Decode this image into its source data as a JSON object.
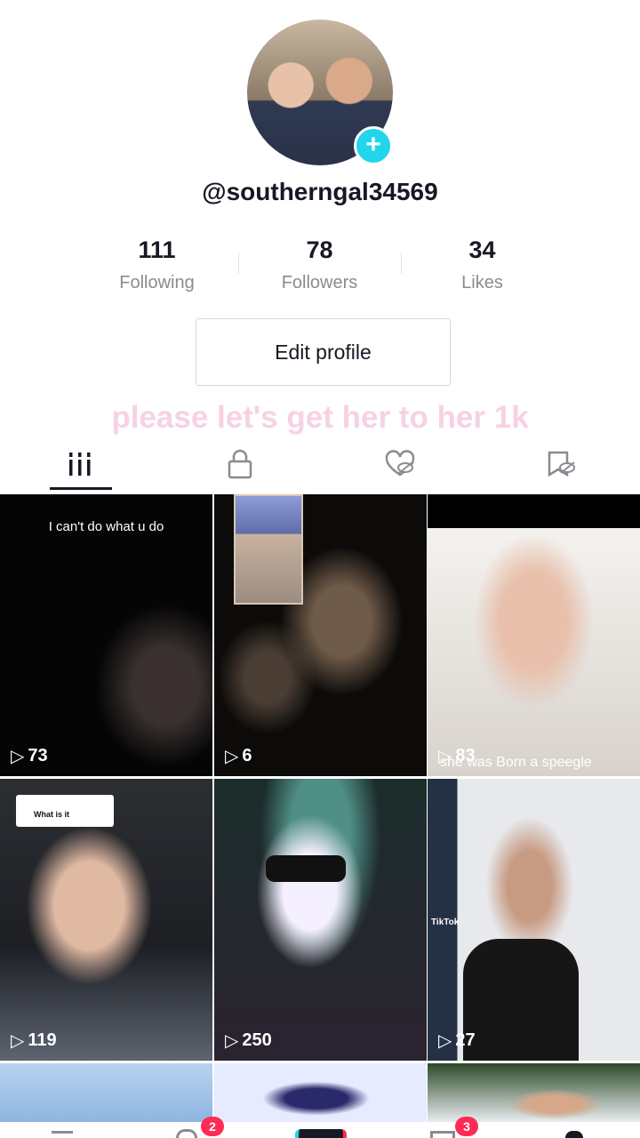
{
  "profile": {
    "username": "@southerngal34569",
    "bio": "please let's get her to her 1k"
  },
  "stats": [
    {
      "value": "111",
      "label": "Following"
    },
    {
      "value": "78",
      "label": "Followers"
    },
    {
      "value": "34",
      "label": "Likes"
    }
  ],
  "actions": {
    "edit_profile": "Edit profile"
  },
  "tabs": [
    {
      "icon": "videos-grid-icon"
    },
    {
      "icon": "private-lock-icon"
    },
    {
      "icon": "liked-heart-hidden-icon"
    },
    {
      "icon": "favorites-hidden-icon"
    }
  ],
  "videos": [
    {
      "views": "73",
      "caption": "I can't do what u do"
    },
    {
      "views": "6",
      "caption": ""
    },
    {
      "views": "83",
      "caption": "she was Born a speegle"
    },
    {
      "views": "119",
      "caption": "What is it"
    },
    {
      "views": "250",
      "caption": ""
    },
    {
      "views": "27",
      "caption": "TikTok"
    }
  ],
  "nav": {
    "inbox_badge": "2",
    "messages_badge": "3"
  },
  "colors": {
    "accent": "#20d5ec",
    "badge": "#fe2c55",
    "bio_text": "#f6d2e4"
  }
}
